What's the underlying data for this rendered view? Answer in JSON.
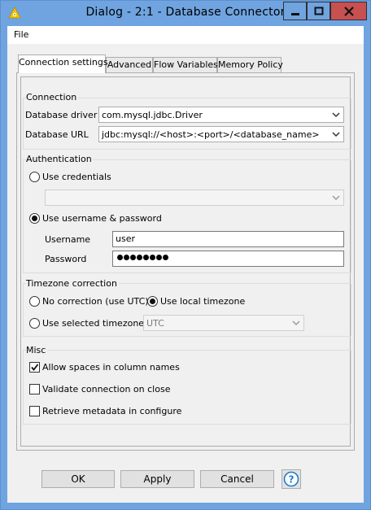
{
  "window": {
    "title": "Dialog - 2:1 - Database Connector",
    "buttons": [
      "minimize-icon",
      "maximize-icon",
      "close-icon"
    ]
  },
  "menu": {
    "file": "File"
  },
  "tabs": [
    {
      "label": "Connection settings",
      "active": true
    },
    {
      "label": "Advanced",
      "active": false
    },
    {
      "label": "Flow Variables",
      "active": false
    },
    {
      "label": "Memory Policy",
      "active": false
    }
  ],
  "connection": {
    "title": "Connection",
    "driver_label": "Database driver",
    "driver_value": "com.mysql.jdbc.Driver",
    "url_label": "Database URL",
    "url_value": "jdbc:mysql://<host>:<port>/<database_name>"
  },
  "authentication": {
    "title": "Authentication",
    "use_credentials": "Use credentials",
    "credentials_value": "",
    "use_username_password": "Use username & password",
    "selected": "username_password",
    "username_label": "Username",
    "username_value": "user",
    "password_label": "Password",
    "password_masked_length": 8
  },
  "timezone": {
    "title": "Timezone correction",
    "no_correction": "No correction (use UTC)",
    "use_local": "Use local timezone",
    "use_selected": "Use selected timezone",
    "selected_tz": "UTC",
    "selected": "local"
  },
  "misc": {
    "title": "Misc",
    "allow_spaces": "Allow spaces in column names",
    "allow_spaces_checked": true,
    "validate_on_close": "Validate connection on close",
    "validate_on_close_checked": false,
    "retrieve_metadata": "Retrieve metadata in configure",
    "retrieve_metadata_checked": false
  },
  "footer": {
    "ok": "OK",
    "apply": "Apply",
    "cancel": "Cancel",
    "help_icon": "help-icon"
  },
  "colors": {
    "titlebar": "#6fa4e0",
    "panel": "#f0f0f0",
    "help_accent": "#1f7bd1"
  }
}
